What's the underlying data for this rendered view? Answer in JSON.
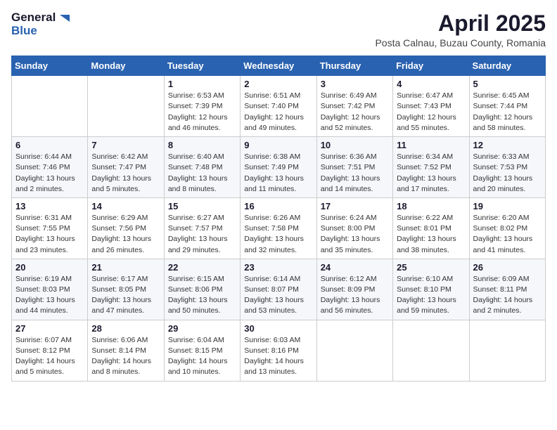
{
  "header": {
    "logo_general": "General",
    "logo_blue": "Blue",
    "title": "April 2025",
    "location": "Posta Calnau, Buzau County, Romania"
  },
  "days_of_week": [
    "Sunday",
    "Monday",
    "Tuesday",
    "Wednesday",
    "Thursday",
    "Friday",
    "Saturday"
  ],
  "weeks": [
    [
      {
        "day": "",
        "info": ""
      },
      {
        "day": "",
        "info": ""
      },
      {
        "day": "1",
        "info": "Sunrise: 6:53 AM\nSunset: 7:39 PM\nDaylight: 12 hours and 46 minutes."
      },
      {
        "day": "2",
        "info": "Sunrise: 6:51 AM\nSunset: 7:40 PM\nDaylight: 12 hours and 49 minutes."
      },
      {
        "day": "3",
        "info": "Sunrise: 6:49 AM\nSunset: 7:42 PM\nDaylight: 12 hours and 52 minutes."
      },
      {
        "day": "4",
        "info": "Sunrise: 6:47 AM\nSunset: 7:43 PM\nDaylight: 12 hours and 55 minutes."
      },
      {
        "day": "5",
        "info": "Sunrise: 6:45 AM\nSunset: 7:44 PM\nDaylight: 12 hours and 58 minutes."
      }
    ],
    [
      {
        "day": "6",
        "info": "Sunrise: 6:44 AM\nSunset: 7:46 PM\nDaylight: 13 hours and 2 minutes."
      },
      {
        "day": "7",
        "info": "Sunrise: 6:42 AM\nSunset: 7:47 PM\nDaylight: 13 hours and 5 minutes."
      },
      {
        "day": "8",
        "info": "Sunrise: 6:40 AM\nSunset: 7:48 PM\nDaylight: 13 hours and 8 minutes."
      },
      {
        "day": "9",
        "info": "Sunrise: 6:38 AM\nSunset: 7:49 PM\nDaylight: 13 hours and 11 minutes."
      },
      {
        "day": "10",
        "info": "Sunrise: 6:36 AM\nSunset: 7:51 PM\nDaylight: 13 hours and 14 minutes."
      },
      {
        "day": "11",
        "info": "Sunrise: 6:34 AM\nSunset: 7:52 PM\nDaylight: 13 hours and 17 minutes."
      },
      {
        "day": "12",
        "info": "Sunrise: 6:33 AM\nSunset: 7:53 PM\nDaylight: 13 hours and 20 minutes."
      }
    ],
    [
      {
        "day": "13",
        "info": "Sunrise: 6:31 AM\nSunset: 7:55 PM\nDaylight: 13 hours and 23 minutes."
      },
      {
        "day": "14",
        "info": "Sunrise: 6:29 AM\nSunset: 7:56 PM\nDaylight: 13 hours and 26 minutes."
      },
      {
        "day": "15",
        "info": "Sunrise: 6:27 AM\nSunset: 7:57 PM\nDaylight: 13 hours and 29 minutes."
      },
      {
        "day": "16",
        "info": "Sunrise: 6:26 AM\nSunset: 7:58 PM\nDaylight: 13 hours and 32 minutes."
      },
      {
        "day": "17",
        "info": "Sunrise: 6:24 AM\nSunset: 8:00 PM\nDaylight: 13 hours and 35 minutes."
      },
      {
        "day": "18",
        "info": "Sunrise: 6:22 AM\nSunset: 8:01 PM\nDaylight: 13 hours and 38 minutes."
      },
      {
        "day": "19",
        "info": "Sunrise: 6:20 AM\nSunset: 8:02 PM\nDaylight: 13 hours and 41 minutes."
      }
    ],
    [
      {
        "day": "20",
        "info": "Sunrise: 6:19 AM\nSunset: 8:03 PM\nDaylight: 13 hours and 44 minutes."
      },
      {
        "day": "21",
        "info": "Sunrise: 6:17 AM\nSunset: 8:05 PM\nDaylight: 13 hours and 47 minutes."
      },
      {
        "day": "22",
        "info": "Sunrise: 6:15 AM\nSunset: 8:06 PM\nDaylight: 13 hours and 50 minutes."
      },
      {
        "day": "23",
        "info": "Sunrise: 6:14 AM\nSunset: 8:07 PM\nDaylight: 13 hours and 53 minutes."
      },
      {
        "day": "24",
        "info": "Sunrise: 6:12 AM\nSunset: 8:09 PM\nDaylight: 13 hours and 56 minutes."
      },
      {
        "day": "25",
        "info": "Sunrise: 6:10 AM\nSunset: 8:10 PM\nDaylight: 13 hours and 59 minutes."
      },
      {
        "day": "26",
        "info": "Sunrise: 6:09 AM\nSunset: 8:11 PM\nDaylight: 14 hours and 2 minutes."
      }
    ],
    [
      {
        "day": "27",
        "info": "Sunrise: 6:07 AM\nSunset: 8:12 PM\nDaylight: 14 hours and 5 minutes."
      },
      {
        "day": "28",
        "info": "Sunrise: 6:06 AM\nSunset: 8:14 PM\nDaylight: 14 hours and 8 minutes."
      },
      {
        "day": "29",
        "info": "Sunrise: 6:04 AM\nSunset: 8:15 PM\nDaylight: 14 hours and 10 minutes."
      },
      {
        "day": "30",
        "info": "Sunrise: 6:03 AM\nSunset: 8:16 PM\nDaylight: 14 hours and 13 minutes."
      },
      {
        "day": "",
        "info": ""
      },
      {
        "day": "",
        "info": ""
      },
      {
        "day": "",
        "info": ""
      }
    ]
  ]
}
